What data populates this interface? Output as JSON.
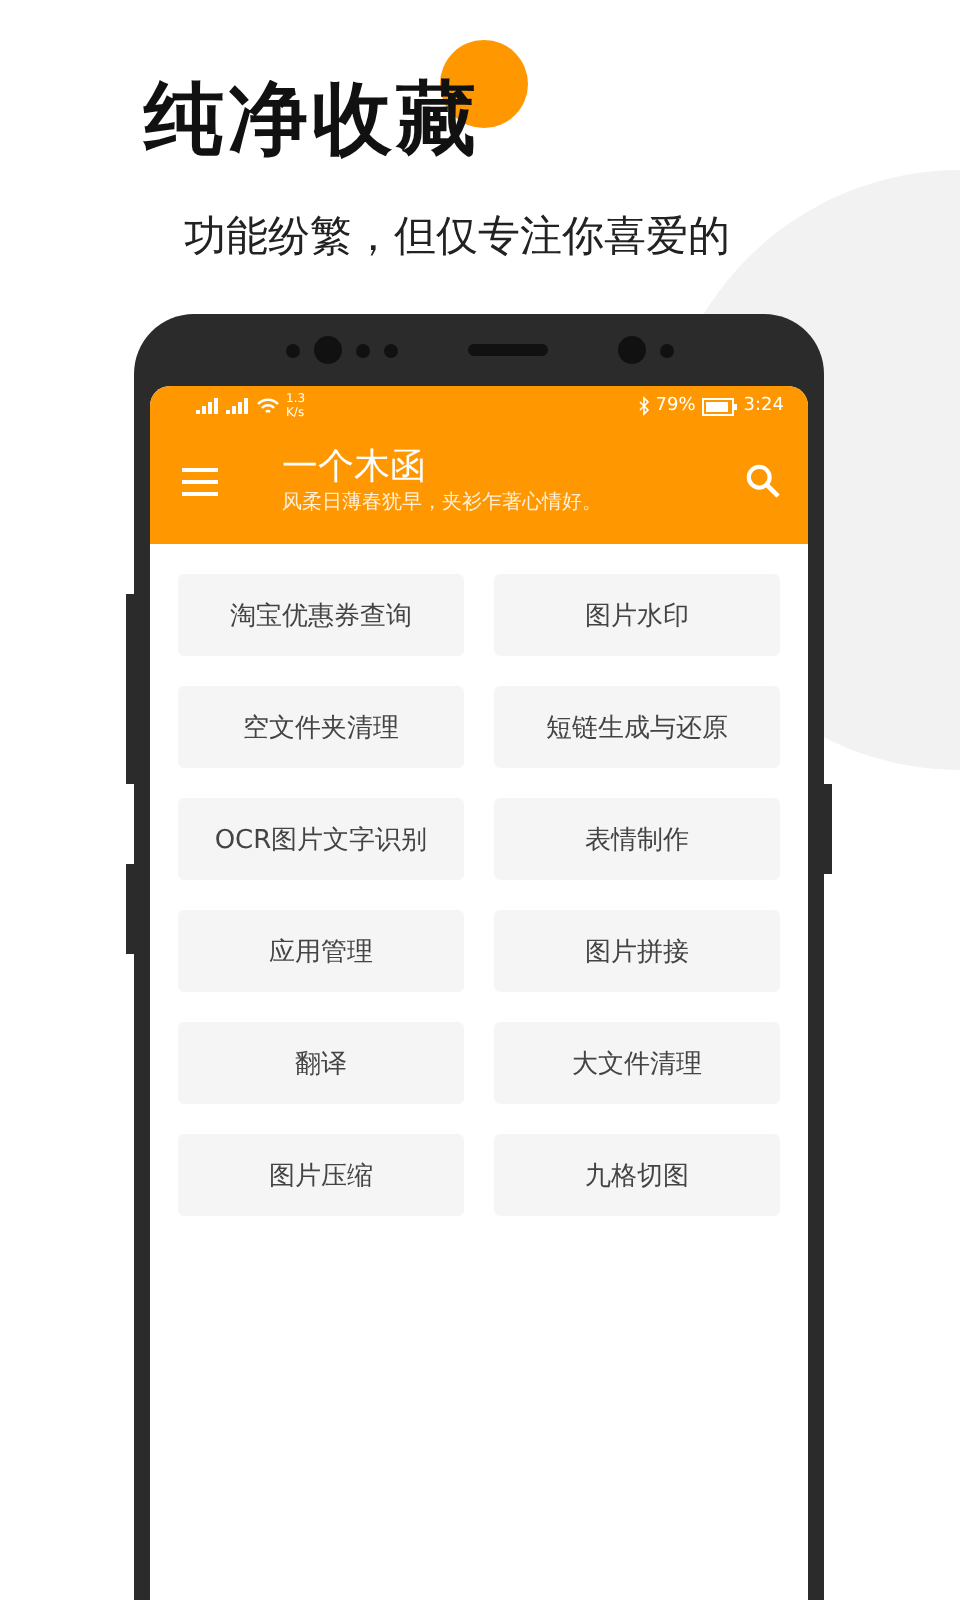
{
  "headline": "纯净收藏",
  "tagline": "功能纷繁，但仅专注你喜爱的",
  "status_bar": {
    "speed": "1.3",
    "speed_unit": "K/s",
    "battery": "79%",
    "time": "3:24"
  },
  "app_bar": {
    "title": "一个木函",
    "subtitle": "风柔日薄春犹早，夹衫乍著心情好。"
  },
  "tools": [
    {
      "label": "淘宝优惠券查询"
    },
    {
      "label": "图片水印"
    },
    {
      "label": "空文件夹清理"
    },
    {
      "label": "短链生成与还原"
    },
    {
      "label": "OCR图片文字识别"
    },
    {
      "label": "表情制作"
    },
    {
      "label": "应用管理"
    },
    {
      "label": "图片拼接"
    },
    {
      "label": "翻译"
    },
    {
      "label": "大文件清理"
    },
    {
      "label": "图片压缩"
    },
    {
      "label": "九格切图"
    }
  ]
}
